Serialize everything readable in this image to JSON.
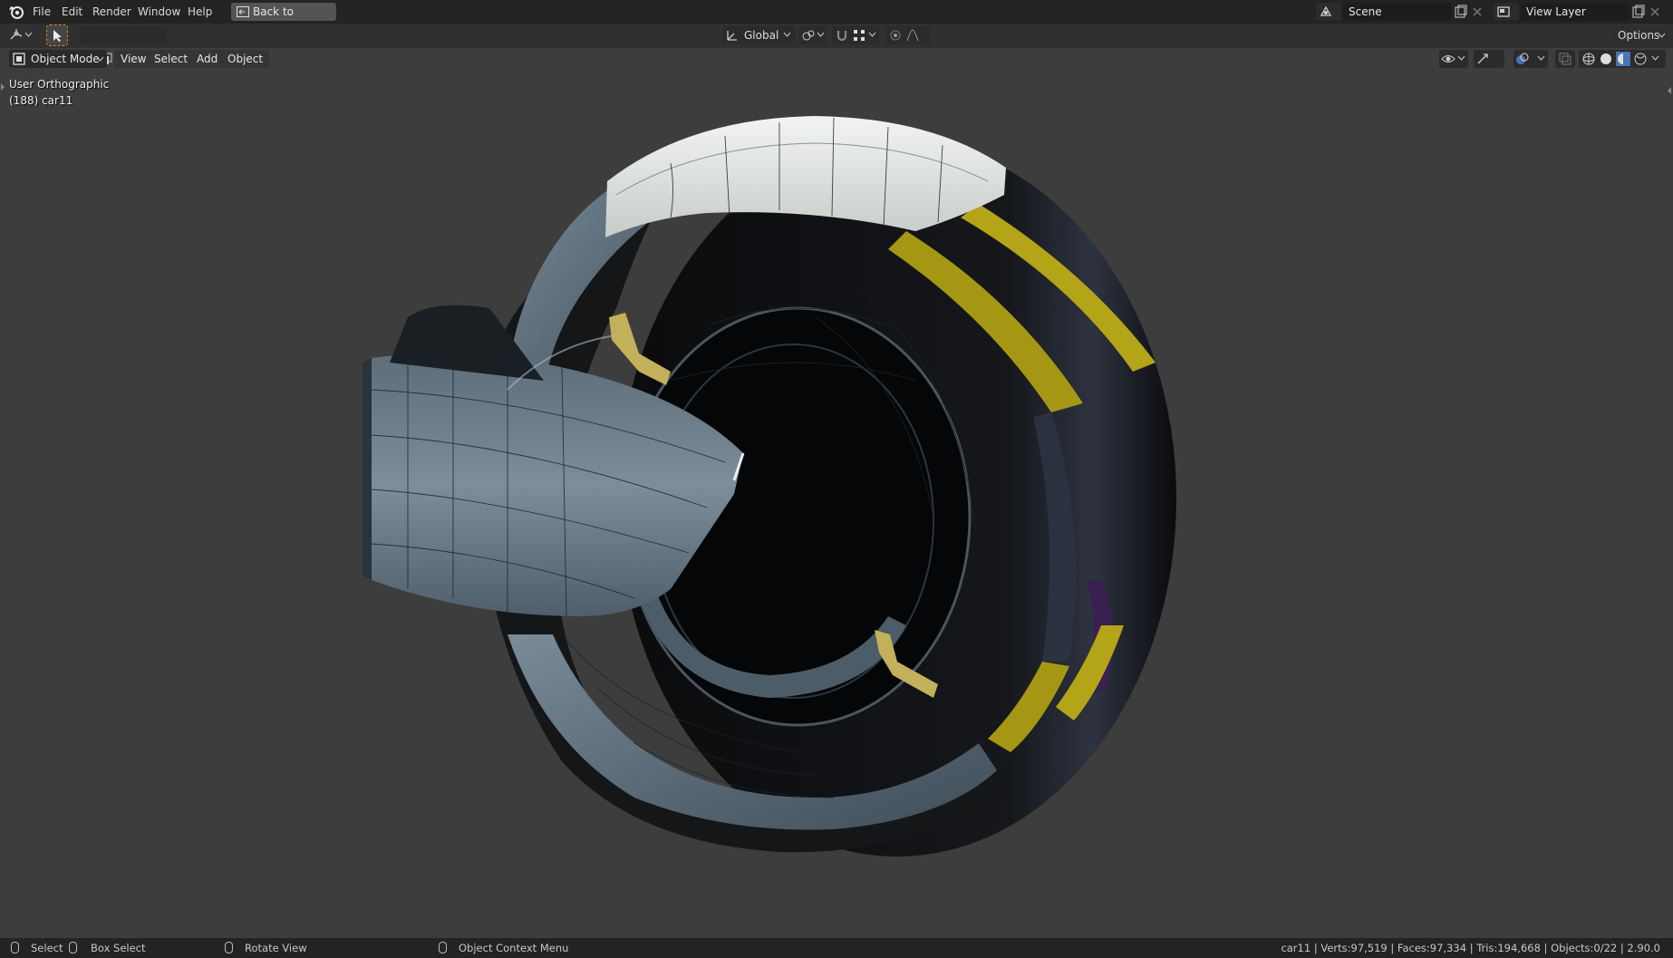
{
  "menu": {
    "items": [
      "File",
      "Edit",
      "Render",
      "Window",
      "Help"
    ],
    "back_button": "Back to Previous"
  },
  "scene": {
    "label": "Scene"
  },
  "view_layer": {
    "label": "View Layer"
  },
  "tool_header": {
    "orientation": "Global",
    "options": "Options"
  },
  "viewport_header": {
    "mode": "Object Mode",
    "menus": [
      "View",
      "Select",
      "Add",
      "Object"
    ]
  },
  "viewport": {
    "view_name": "User Orthographic",
    "object_info": "(188) car11"
  },
  "status_bar": {
    "select": "Select",
    "box_select": "Box Select",
    "rotate_view": "Rotate View",
    "context_menu": "Object Context Menu",
    "stats": "car11 | Verts:97,519 | Faces:97,334 | Tris:194,668 | Objects:0/22 | 2.90.0"
  },
  "colors": {
    "viewport_bg": "#3d3d3d",
    "accent_yellow": "#b4a418",
    "body_blue_gray": "#5a6b7a",
    "header_dark": "#232323"
  }
}
